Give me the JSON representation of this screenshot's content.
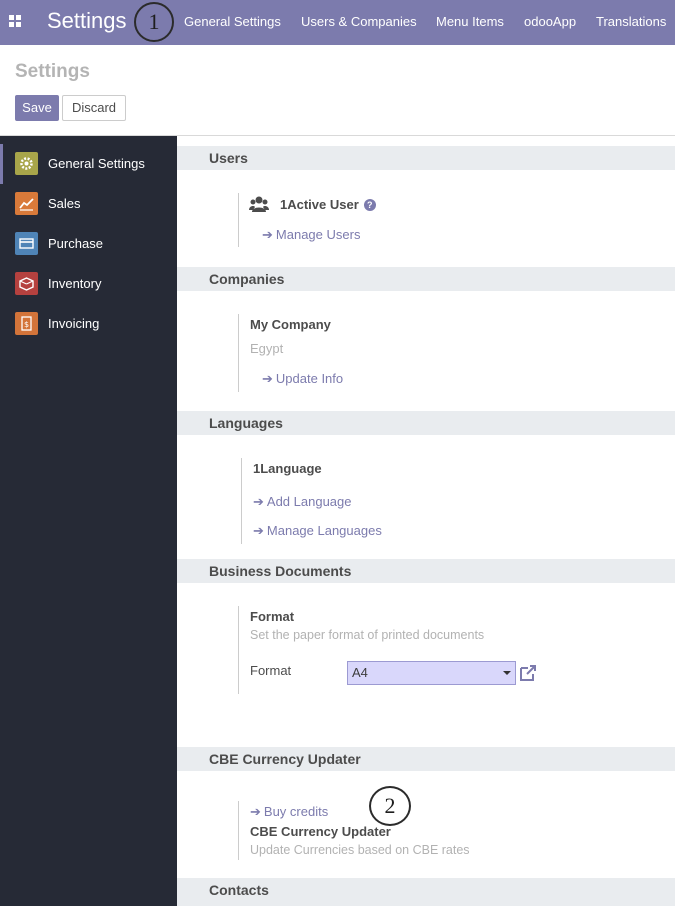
{
  "navbar": {
    "title": "Settings",
    "menu": [
      "General Settings",
      "Users & Companies",
      "Menu Items",
      "odooApp",
      "Translations"
    ],
    "callout_1": "1"
  },
  "control_panel": {
    "title": "Settings",
    "save_label": "Save",
    "discard_label": "Discard"
  },
  "sidebar": {
    "items": [
      {
        "label": "General Settings",
        "icon": "gear-icon",
        "color": "#a8a54a"
      },
      {
        "label": "Sales",
        "icon": "chart-icon",
        "color": "#d97a3a"
      },
      {
        "label": "Purchase",
        "icon": "card-icon",
        "color": "#4f84b7"
      },
      {
        "label": "Inventory",
        "icon": "box-icon",
        "color": "#b5413f"
      },
      {
        "label": "Invoicing",
        "icon": "invoice-icon",
        "color": "#d3743a"
      }
    ]
  },
  "users": {
    "title": "Users",
    "active_users": "1Active User",
    "help": "?",
    "manage_users": "Manage Users"
  },
  "companies": {
    "title": "Companies",
    "company_name": "My Company",
    "country": "Egypt",
    "update_info": "Update Info"
  },
  "languages": {
    "title": "Languages",
    "count": "1Language",
    "add_language": "Add Language",
    "manage_languages": "Manage Languages"
  },
  "business_documents": {
    "title": "Business Documents",
    "format_heading": "Format",
    "format_desc": "Set the paper format of printed documents",
    "format_label": "Format",
    "format_value": "A4"
  },
  "cbe": {
    "title": "CBE Currency Updater",
    "buy_credits": "Buy credits",
    "heading": "CBE Currency Updater",
    "desc": "Update Currencies based on CBE rates",
    "callout_2": "2"
  },
  "contacts": {
    "title": "Contacts"
  },
  "colors": {
    "brand": "#7c7bad",
    "sidebar_bg": "#262a36",
    "section_bg": "#e9ecef"
  }
}
